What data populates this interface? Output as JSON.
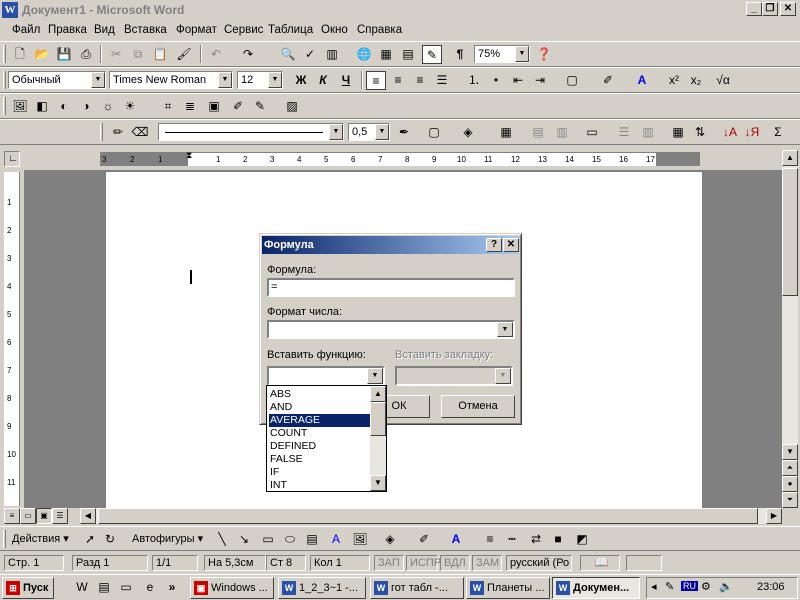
{
  "window": {
    "title": "Документ1 - Microsoft Word",
    "app_icon": "W"
  },
  "menu": [
    "Файл",
    "Правка",
    "Вид",
    "Вставка",
    "Формат",
    "Сервис",
    "Таблица",
    "Окно",
    "Справка"
  ],
  "toolbar": {
    "zoom": "75%",
    "style": "Обычный",
    "font": "Times New Roman",
    "size": "12",
    "bold": "Ж",
    "italic": "К",
    "underline": "Ч",
    "line_weight": "0,5",
    "pilcrow": "¶"
  },
  "ruler": {
    "ticks": [
      "3",
      "2",
      "1",
      "1",
      "2",
      "3",
      "4",
      "5",
      "6",
      "7",
      "8",
      "9",
      "10",
      "11",
      "12",
      "13",
      "14",
      "15",
      "16",
      "17"
    ],
    "vticks": [
      "1",
      "2",
      "3",
      "4",
      "5",
      "6",
      "7",
      "8",
      "9",
      "10",
      "11"
    ]
  },
  "dialog": {
    "title": "Формула",
    "help": "?",
    "close": "✕",
    "formula_label": "Формула:",
    "formula_value": "=",
    "number_format_label": "Формат числа:",
    "insert_function_label": "Вставить функцию:",
    "insert_bookmark_label": "Вставить закладку:",
    "ok": "ОК",
    "cancel": "Отмена",
    "functions": [
      "ABS",
      "AND",
      "AVERAGE",
      "COUNT",
      "DEFINED",
      "FALSE",
      "IF",
      "INT"
    ],
    "selected_function": "AVERAGE"
  },
  "drawing": {
    "actions": "Действия",
    "autoshapes": "Автофигуры"
  },
  "status": {
    "page": "Стр. 1",
    "section": "Разд 1",
    "pages": "1/1",
    "at": "На 5,3см",
    "line": "Ст 8",
    "col": "Кол 1",
    "rec": "ЗАП",
    "trk": "ИСПР",
    "ext": "ВДЛ",
    "ovr": "ЗАМ",
    "lang": "русский (Ро"
  },
  "taskbar": {
    "start": "Пуск",
    "tasks": [
      "Windows ...",
      "1_2_3~1 -...",
      "гот табл -...",
      "Планеты ...",
      "Докумен..."
    ],
    "clock": "23:06",
    "lang": "RU"
  }
}
